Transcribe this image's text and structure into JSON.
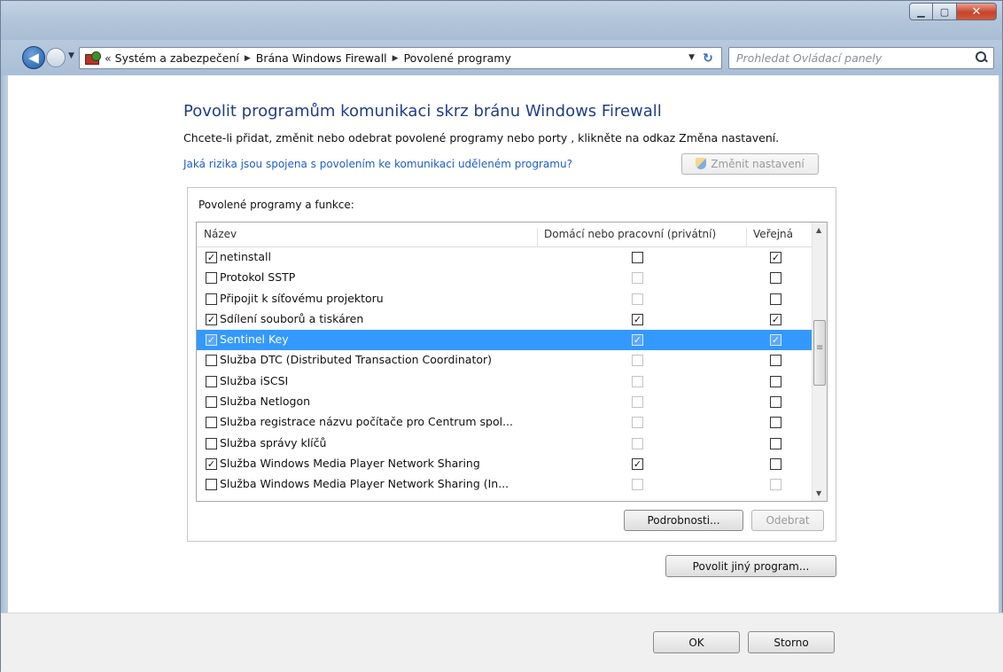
{
  "breadcrumb": [
    "Systém a zabezpečení",
    "Brána Windows Firewall",
    "Povolené programy"
  ],
  "search": {
    "placeholder": "Prohledat Ovládací panely"
  },
  "main": {
    "title": "Povolit programům komunikaci skrz bránu Windows Firewall",
    "subtitle": "Chcete-li přidat, změnit nebo odebrat povolené programy nebo porty , klikněte na odkaz Změna nastavení.",
    "risk_link": "Jaká rizika jsou spojena s povolením ke komunikaci uděleném programu?",
    "change_settings_label": "Změnit nastavení",
    "group_label": "Povolené programy a funkce:",
    "columns": {
      "name": "Název",
      "private": "Domácí nebo pracovní (privátní)",
      "public": "Veřejná"
    },
    "rows": [
      {
        "name": "netinstall",
        "enabled": true,
        "private": false,
        "public": true
      },
      {
        "name": "Protokol SSTP",
        "enabled": false,
        "private": false,
        "public": false
      },
      {
        "name": "Připojit k síťovému projektoru",
        "enabled": false,
        "private": false,
        "public": false
      },
      {
        "name": "Sdílení souborů a tiskáren",
        "enabled": true,
        "private": true,
        "public": true
      },
      {
        "name": "Sentinel Key",
        "enabled": true,
        "private": true,
        "public": true,
        "selected": true
      },
      {
        "name": "Služba DTC (Distributed Transaction Coordinator)",
        "enabled": false,
        "private": false,
        "public": false
      },
      {
        "name": "Služba iSCSI",
        "enabled": false,
        "private": false,
        "public": false
      },
      {
        "name": "Služba Netlogon",
        "enabled": false,
        "private": false,
        "public": false
      },
      {
        "name": "Služba registrace názvu počítače pro Centrum spol...",
        "enabled": false,
        "private": false,
        "public": false
      },
      {
        "name": "Služba správy klíčů",
        "enabled": false,
        "private": false,
        "public": false
      },
      {
        "name": "Služba Windows Media Player Network Sharing",
        "enabled": true,
        "private": true,
        "public": false
      },
      {
        "name": "Služba Windows Media Player Network Sharing (In...",
        "enabled": false,
        "private": false,
        "public": false
      }
    ],
    "details_label": "Podrobnosti...",
    "remove_label": "Odebrat",
    "allow_other_label": "Povolit jiný program..."
  },
  "footer": {
    "ok_label": "OK",
    "cancel_label": "Storno"
  }
}
